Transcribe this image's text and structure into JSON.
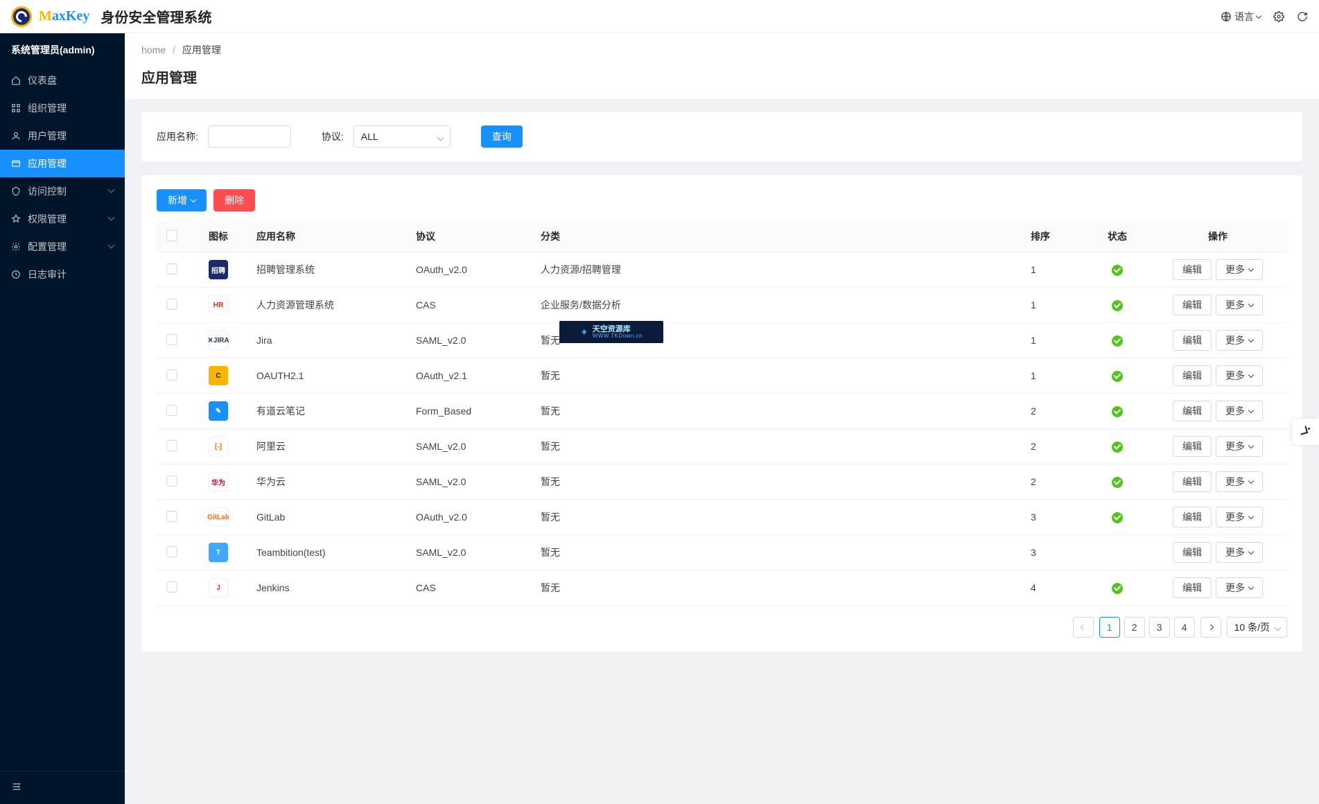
{
  "header": {
    "logo_text_m": "M",
    "logo_text_rest": "axKey",
    "system_title": "身份安全管理系统",
    "lang_label": "语言"
  },
  "sidebar": {
    "user": "系统管理员(admin)",
    "items": [
      {
        "label": "仪表盘",
        "icon": "home-icon",
        "active": false,
        "sub": false
      },
      {
        "label": "组织管理",
        "icon": "org-icon",
        "active": false,
        "sub": false
      },
      {
        "label": "用户管理",
        "icon": "user-icon",
        "active": false,
        "sub": false
      },
      {
        "label": "应用管理",
        "icon": "app-icon",
        "active": true,
        "sub": false
      },
      {
        "label": "访问控制",
        "icon": "shield-icon",
        "active": false,
        "sub": true
      },
      {
        "label": "权限管理",
        "icon": "perm-icon",
        "active": false,
        "sub": true
      },
      {
        "label": "配置管理",
        "icon": "config-icon",
        "active": false,
        "sub": true
      },
      {
        "label": "日志审计",
        "icon": "log-icon",
        "active": false,
        "sub": false
      }
    ]
  },
  "breadcrumb": {
    "home": "home",
    "current": "应用管理"
  },
  "page": {
    "title": "应用管理"
  },
  "search": {
    "name_label": "应用名称:",
    "protocol_label": "协议:",
    "protocol_value": "ALL",
    "submit": "查询"
  },
  "toolbar": {
    "add": "新增",
    "delete": "删除"
  },
  "table": {
    "columns": {
      "icon": "图标",
      "name": "应用名称",
      "protocol": "协议",
      "category": "分类",
      "sort": "排序",
      "status": "状态",
      "ops": "操作"
    },
    "ops": {
      "edit": "编辑",
      "more": "更多"
    },
    "rows": [
      {
        "icon": {
          "text": "招聘",
          "bg": "#1a2a6c",
          "fg": "#fff"
        },
        "name": "招聘管理系统",
        "protocol": "OAuth_v2.0",
        "category": "人力资源/招聘管理",
        "sort": "1",
        "status": true
      },
      {
        "icon": {
          "text": "HR",
          "bg": "#fff",
          "fg": "#e1251b"
        },
        "name": "人力资源管理系统",
        "protocol": "CAS",
        "category": "企业服务/数据分析",
        "sort": "1",
        "status": true
      },
      {
        "icon": {
          "text": "✕JIRA",
          "bg": "#fff",
          "fg": "#253858"
        },
        "name": "Jira",
        "protocol": "SAML_v2.0",
        "category": "暂无",
        "sort": "1",
        "status": true
      },
      {
        "icon": {
          "text": "C",
          "bg": "#f7b500",
          "fg": "#1a2a6c"
        },
        "name": "OAUTH2.1",
        "protocol": "OAuth_v2.1",
        "category": "暂无",
        "sort": "1",
        "status": true
      },
      {
        "icon": {
          "text": "✎",
          "bg": "#1890ff",
          "fg": "#fff"
        },
        "name": "有道云笔记",
        "protocol": "Form_Based",
        "category": "暂无",
        "sort": "2",
        "status": true
      },
      {
        "icon": {
          "text": "[-]",
          "bg": "#fff",
          "fg": "#ff6a00"
        },
        "name": "阿里云",
        "protocol": "SAML_v2.0",
        "category": "暂无",
        "sort": "2",
        "status": true
      },
      {
        "icon": {
          "text": "华为",
          "bg": "#fff",
          "fg": "#cf0a2c"
        },
        "name": "华为云",
        "protocol": "SAML_v2.0",
        "category": "暂无",
        "sort": "2",
        "status": true
      },
      {
        "icon": {
          "text": "GitLab",
          "bg": "#fff",
          "fg": "#fc6d26"
        },
        "name": "GitLab",
        "protocol": "OAuth_v2.0",
        "category": "暂无",
        "sort": "3",
        "status": true
      },
      {
        "icon": {
          "text": "T",
          "bg": "#40a9ff",
          "fg": "#fff"
        },
        "name": "Teambition(test)",
        "protocol": "SAML_v2.0",
        "category": "暂无",
        "sort": "3",
        "status": false
      },
      {
        "icon": {
          "text": "J",
          "bg": "#fff",
          "fg": "#d33833"
        },
        "name": "Jenkins",
        "protocol": "CAS",
        "category": "暂无",
        "sort": "4",
        "status": true
      }
    ]
  },
  "pager": {
    "pages": [
      "1",
      "2",
      "3",
      "4"
    ],
    "current": "1",
    "size_label": "10 条/页"
  },
  "watermark": {
    "line1": "天空资源库",
    "line2": "WWW.TKDown.cn"
  }
}
